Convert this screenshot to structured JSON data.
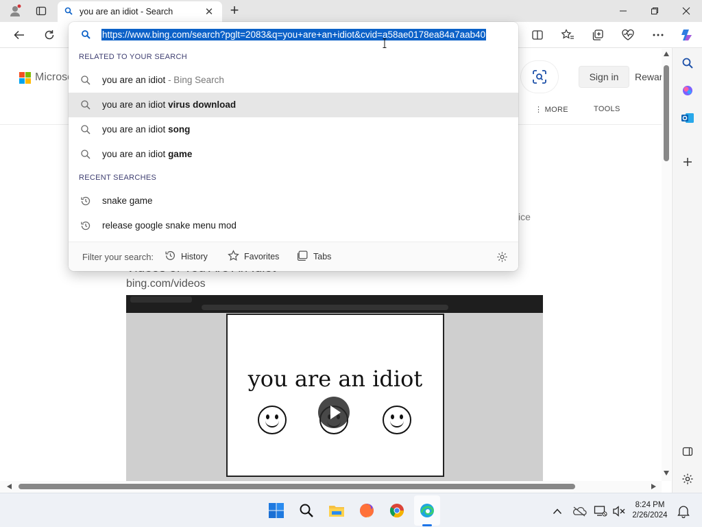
{
  "browser": {
    "tab": {
      "title": "you are an idiot - Search"
    },
    "address_url": "https://www.bing.com/search?pglt=2083&q=you+are+an+idiot&cvid=a58ae0178ea84a7aab40"
  },
  "dropdown": {
    "related_label": "RELATED TO YOUR SEARCH",
    "suggestions": [
      {
        "base": "you are an idiot",
        "suffix": "",
        "note": " - Bing Search",
        "highlighted": false
      },
      {
        "base": "you are an idiot ",
        "suffix": "virus download",
        "note": "",
        "highlighted": true
      },
      {
        "base": "you are an idiot ",
        "suffix": "song",
        "note": "",
        "highlighted": false
      },
      {
        "base": "you are an idiot ",
        "suffix": "game",
        "note": "",
        "highlighted": false
      }
    ],
    "recent_label": "RECENT SEARCHES",
    "recent": [
      {
        "text": "snake game"
      },
      {
        "text": "release google snake menu mod"
      }
    ],
    "filter": {
      "label": "Filter your search:",
      "history": "History",
      "favorites": "Favorites",
      "tabs": "Tabs"
    }
  },
  "page": {
    "logo_text": "Microso",
    "signin_label": "Sign in",
    "rewards_label": "Rewar",
    "more_label": "MORE",
    "tools_label": "TOOLS",
    "partial_text": "ice",
    "videos_title": "Videos of You Are An Idiot",
    "videos_url": "bing.com/videos",
    "video_caption": "you are an idiot"
  },
  "taskbar": {
    "time": "8:24 PM",
    "date": "2/26/2024"
  },
  "colors": {
    "accent": "#0b61c8",
    "ms_red": "#f25022",
    "ms_green": "#7fba00",
    "ms_blue": "#00a4ef",
    "ms_yellow": "#ffb900"
  }
}
